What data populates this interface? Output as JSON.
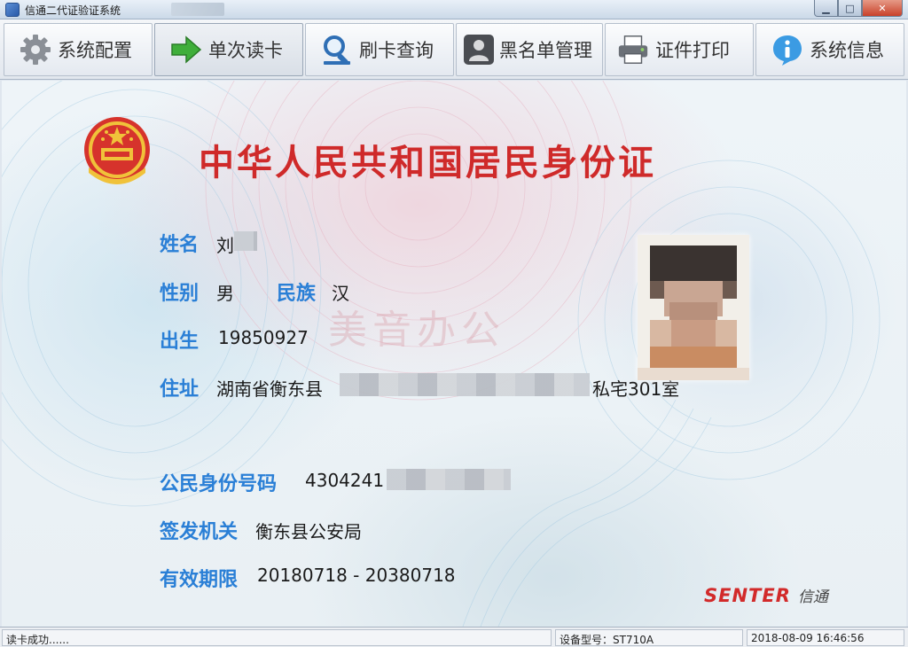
{
  "window": {
    "title": "信通二代证验证系统"
  },
  "toolbar": {
    "buttons": [
      {
        "label": "系统配置",
        "icon": "gear-icon"
      },
      {
        "label": "单次读卡",
        "icon": "arrow-right-icon"
      },
      {
        "label": "刷卡查询",
        "icon": "search-icon"
      },
      {
        "label": "黑名单管理",
        "icon": "person-icon"
      },
      {
        "label": "证件打印",
        "icon": "printer-icon"
      },
      {
        "label": "系统信息",
        "icon": "info-icon"
      }
    ]
  },
  "card": {
    "title": "中华人民共和国居民身份证",
    "watermark": "美音办公",
    "fields": {
      "name_label": "姓名",
      "name_value": "刘",
      "gender_label": "性别",
      "gender_value": "男",
      "ethnicity_label": "民族",
      "ethnicity_value": "汉",
      "birth_label": "出生",
      "birth_value": "19850927",
      "address_label": "住址",
      "address_prefix": "湖南省衡东县",
      "address_suffix": "私宅301室",
      "id_label": "公民身份号码",
      "id_value": "4304241",
      "authority_label": "签发机关",
      "authority_value": "衡东县公安局",
      "validity_label": "有效期限",
      "validity_value": "20180718 - 20380718"
    },
    "brand": {
      "logo_text": "SENTER",
      "chinese": "信通"
    }
  },
  "status": {
    "message": "读卡成功......",
    "device": "设备型号：ST710A",
    "datetime": "2018-08-09 16:46:56"
  },
  "colors": {
    "label_blue": "#2a7fd6",
    "title_red": "#cf2a2a",
    "brand_red": "#d22a2a"
  }
}
